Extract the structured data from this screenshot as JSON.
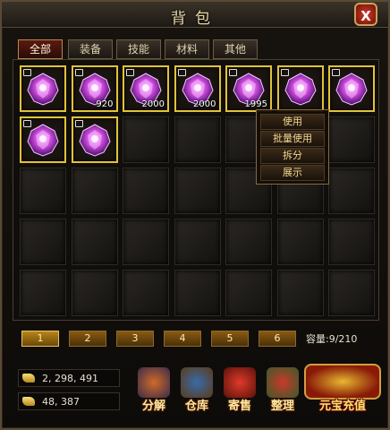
{
  "window": {
    "title": "背包",
    "close_label": "X"
  },
  "tabs": [
    {
      "label": "全部",
      "active": true
    },
    {
      "label": "装备",
      "active": false
    },
    {
      "label": "技能",
      "active": false
    },
    {
      "label": "材料",
      "active": false
    },
    {
      "label": "其他",
      "active": false
    }
  ],
  "colors": {
    "accent_gold": "#e2c23a",
    "gem_purple": "#b040c8",
    "frame": "#5a4a35"
  },
  "inventory": {
    "items": [
      {
        "icon": "purple-gem-icon",
        "qty": ""
      },
      {
        "icon": "purple-gem-icon",
        "qty": "920"
      },
      {
        "icon": "purple-gem-icon",
        "qty": "2000"
      },
      {
        "icon": "purple-gem-icon",
        "qty": "2000"
      },
      {
        "icon": "purple-gem-icon",
        "qty": "1995"
      },
      {
        "icon": "purple-gem-icon",
        "qty": ""
      },
      {
        "icon": "purple-gem-icon",
        "qty": ""
      },
      {
        "icon": "purple-gem-icon",
        "qty": ""
      },
      {
        "icon": "purple-gem-icon",
        "qty": ""
      }
    ]
  },
  "context_menu": {
    "items": [
      "使用",
      "批量使用",
      "拆分",
      "展示"
    ]
  },
  "pagination": {
    "pages": [
      "1",
      "2",
      "3",
      "4",
      "5",
      "6"
    ],
    "active": "1"
  },
  "capacity": "容量:9/210",
  "currency": {
    "gold": "2, 298, 491",
    "bound_gold": "48, 387"
  },
  "actions": [
    {
      "label": "分解",
      "icon": "anvil-icon"
    },
    {
      "label": "仓库",
      "icon": "treasure-chest-icon"
    },
    {
      "label": "寄售",
      "icon": "money-bag-icon"
    },
    {
      "label": "整理",
      "icon": "backpack-icon"
    }
  ],
  "recharge": {
    "label": "元宝充值",
    "icon": "gold-ingot-icon"
  }
}
